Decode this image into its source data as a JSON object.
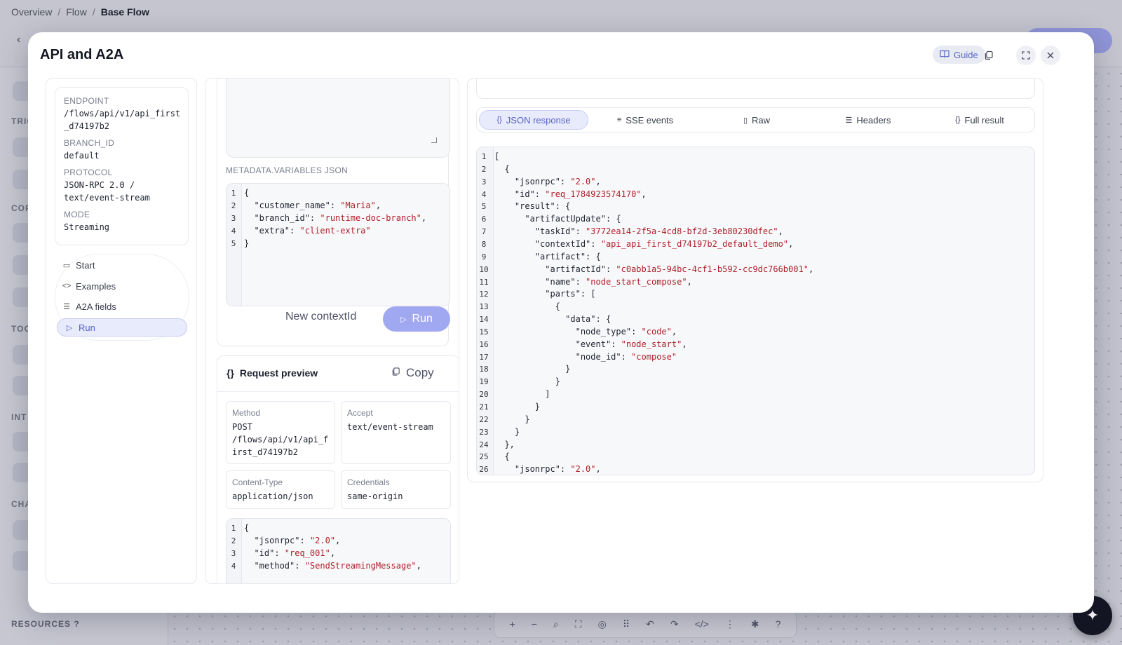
{
  "breadcrumb": [
    "Overview",
    "Flow",
    "Base Flow"
  ],
  "background": {
    "sections": [
      "TRIG",
      "COF",
      "TOO",
      "INT",
      "CHA",
      "RESOURCES"
    ],
    "resources_help": "?"
  },
  "modal": {
    "title": "API and A2A",
    "guide_label": "Guide"
  },
  "info": {
    "endpoint_label": "ENDPOINT",
    "endpoint_value_1": "/flows/api/v1/api_first",
    "endpoint_value_2": "_d74197b2",
    "branch_label": "BRANCH_ID",
    "branch_value": "default",
    "protocol_label": "PROTOCOL",
    "protocol_value_1": "JSON-RPC 2.0 /",
    "protocol_value_2": "text/event-stream",
    "mode_label": "MODE",
    "mode_value": "Streaming"
  },
  "nav": [
    "Start",
    "Examples",
    "A2A fields",
    "Run"
  ],
  "run_panel": {
    "metadata_label": "METADATA.VARIABLES JSON",
    "metadata_lines": [
      {
        "n": "1",
        "t": "{"
      },
      {
        "n": "2",
        "k": "  \"customer_name\": ",
        "s": "\"Maria\"",
        "e": ","
      },
      {
        "n": "3",
        "k": "  \"branch_id\": ",
        "s": "\"runtime-doc-branch\"",
        "e": ","
      },
      {
        "n": "4",
        "k": "  \"extra\": ",
        "s": "\"client-extra\"",
        "e": ""
      },
      {
        "n": "5",
        "t": "}"
      }
    ],
    "new_context_label": "New contextId",
    "run_label": "Run"
  },
  "request_preview": {
    "title": "Request preview",
    "copy_label": "Copy",
    "method_label": "Method",
    "method_value_1": "POST",
    "method_value_2": "/flows/api/v1/api_f",
    "method_value_3": "irst_d74197b2",
    "accept_label": "Accept",
    "accept_value": "text/event-stream",
    "content_type_label": "Content-Type",
    "content_type_value": "application/json",
    "credentials_label": "Credentials",
    "credentials_value": "same-origin",
    "body_lines": [
      {
        "n": "1",
        "t": "{"
      },
      {
        "n": "2",
        "k": "  \"jsonrpc\": ",
        "s": "\"2.0\"",
        "e": ","
      },
      {
        "n": "3",
        "k": "  \"id\": ",
        "s": "\"req_001\"",
        "e": ","
      },
      {
        "n": "4",
        "k": "  \"method\": ",
        "s": "\"SendStreamingMessage\"",
        "e": ","
      }
    ]
  },
  "response": {
    "tabs": [
      "JSON response",
      "SSE events",
      "Raw",
      "Headers",
      "Full result"
    ],
    "lines": [
      {
        "n": "1",
        "t": "["
      },
      {
        "n": "2",
        "t": "  {"
      },
      {
        "n": "3",
        "k": "    \"jsonrpc\": ",
        "s": "\"2.0\"",
        "e": ","
      },
      {
        "n": "4",
        "k": "    \"id\": ",
        "s": "\"req_1784923574170\"",
        "e": ","
      },
      {
        "n": "5",
        "t": "    \"result\": {"
      },
      {
        "n": "6",
        "t": "      \"artifactUpdate\": {"
      },
      {
        "n": "7",
        "k": "        \"taskId\": ",
        "s": "\"3772ea14-2f5a-4cd8-bf2d-3eb80230dfec\"",
        "e": ","
      },
      {
        "n": "8",
        "k": "        \"contextId\": ",
        "s": "\"api_api_first_d74197b2_default_demo\"",
        "e": ","
      },
      {
        "n": "9",
        "t": "        \"artifact\": {"
      },
      {
        "n": "10",
        "k": "          \"artifactId\": ",
        "s": "\"c0abb1a5-94bc-4cf1-b592-cc9dc766b001\"",
        "e": ","
      },
      {
        "n": "11",
        "k": "          \"name\": ",
        "s": "\"node_start_compose\"",
        "e": ","
      },
      {
        "n": "12",
        "t": "          \"parts\": ["
      },
      {
        "n": "13",
        "t": "            {"
      },
      {
        "n": "14",
        "t": "              \"data\": {"
      },
      {
        "n": "15",
        "k": "                \"node_type\": ",
        "s": "\"code\"",
        "e": ","
      },
      {
        "n": "16",
        "k": "                \"event\": ",
        "s": "\"node_start\"",
        "e": ","
      },
      {
        "n": "17",
        "k": "                \"node_id\": ",
        "s": "\"compose\"",
        "e": ""
      },
      {
        "n": "18",
        "t": "              }"
      },
      {
        "n": "19",
        "t": "            }"
      },
      {
        "n": "20",
        "t": "          ]"
      },
      {
        "n": "21",
        "t": "        }"
      },
      {
        "n": "22",
        "t": "      }"
      },
      {
        "n": "23",
        "t": "    }"
      },
      {
        "n": "24",
        "t": "  },"
      },
      {
        "n": "25",
        "t": "  {"
      },
      {
        "n": "26",
        "k": "    \"jsonrpc\": ",
        "s": "\"2.0\"",
        "e": ","
      }
    ]
  },
  "colors": {
    "accent": "#5661c8",
    "run_button": "#a1a8f2",
    "string": "#b0202a"
  }
}
